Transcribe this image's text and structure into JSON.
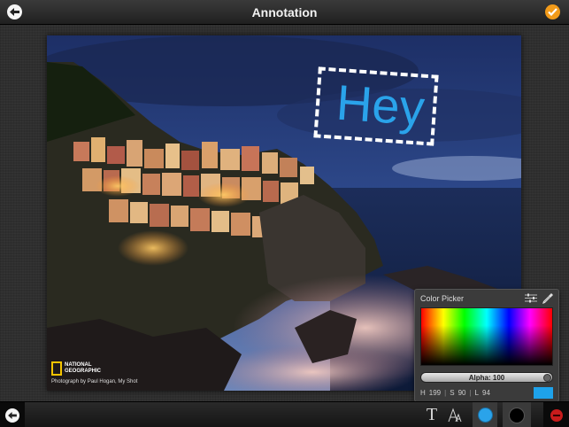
{
  "header": {
    "title": "Annotation"
  },
  "annotation": {
    "text": "Hey",
    "text_color": "#2aa3ea"
  },
  "photo": {
    "logo_text_line1": "NATIONAL",
    "logo_text_line2": "GEOGRAPHIC",
    "credit": "Photograph by Paul Hogan, My Shot"
  },
  "color_picker": {
    "title": "Color Picker",
    "alpha_label": "Alpha: 100",
    "h_label": "H",
    "h_value": "199",
    "s_label": "S",
    "s_value": "90",
    "l_label": "L",
    "l_value": "94",
    "swatch_color": "#1ea2ea"
  },
  "toolbar": {
    "text_tool_glyph": "T",
    "selected_color": "#2aa3ea",
    "stroke_color": "#000000",
    "delete_color": "#c81c1c"
  },
  "icons": [
    "back-arrow-icon",
    "checkmark-icon",
    "sliders-icon",
    "eyedropper-icon",
    "text-icon",
    "font-size-icon",
    "color-dot-icon",
    "stroke-dot-icon",
    "delete-icon"
  ]
}
